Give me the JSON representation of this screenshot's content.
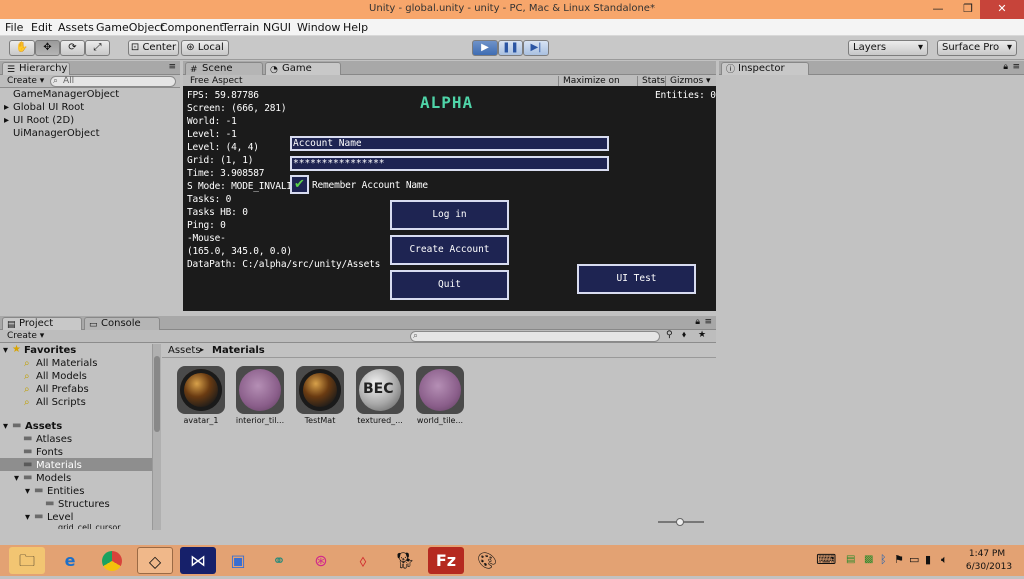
{
  "window": {
    "title": "Unity - global.unity - unity - PC, Mac & Linux Standalone*"
  },
  "menu": [
    "File",
    "Edit",
    "Assets",
    "GameObject",
    "Component",
    "Terrain",
    "NGUI",
    "Window",
    "Help"
  ],
  "toolbar": {
    "pivot": "Center",
    "space": "Local",
    "layers": "Layers",
    "layout": "Surface Pro"
  },
  "hierarchy": {
    "tab": "Hierarchy",
    "create": "Create",
    "search_placeholder": "All",
    "items": [
      "GameManagerObject",
      "Global UI Root",
      "UI Root (2D)",
      "UiManagerObject"
    ]
  },
  "tabs": {
    "scene": "Scene",
    "game": "Game",
    "inspector": "Inspector",
    "project": "Project",
    "console": "Console"
  },
  "game": {
    "aspect": "Free Aspect",
    "maximize": "Maximize on Play",
    "stats": "Stats",
    "gizmos": "Gizmos",
    "logo": "ALPHA",
    "entities": "Entities: 0",
    "debug": [
      "FPS: 59.87786",
      "Screen: (666, 281)",
      "World: -1",
      "Level: -1",
      "Level: (4, 4)",
      "Grid: (1, 1)",
      "Time: 3.908587",
      "S Mode: MODE_INVALID",
      "Tasks: 0",
      "Tasks HB: 0",
      "Ping: 0",
      "-Mouse-",
      "(165.0, 345.0, 0.0)",
      "DataPath: C:/alpha/src/unity/Assets"
    ],
    "account_name": "Account Name",
    "password": "****************",
    "remember": "Remember Account Name",
    "login": "Log in",
    "create_account": "Create Account",
    "quit": "Quit",
    "ui_test": "UI Test"
  },
  "project": {
    "create": "Create",
    "breadcrumb_root": "Assets",
    "breadcrumb_current": "Materials",
    "favorites_label": "Favorites",
    "favorites": [
      "All Materials",
      "All Models",
      "All Prefabs",
      "All Scripts"
    ],
    "assets_label": "Assets",
    "folders": [
      "Atlases",
      "Fonts",
      "Materials",
      "Models",
      "Entities",
      "Structures",
      "Level",
      "grid_cell_cursor"
    ],
    "materials": [
      {
        "name": "avatar_1"
      },
      {
        "name": "interior_til..."
      },
      {
        "name": "TestMat"
      },
      {
        "name": "textured_..."
      },
      {
        "name": "world_tile..."
      }
    ]
  },
  "taskbar": {
    "time": "1:47 PM",
    "date": "6/30/2013"
  }
}
